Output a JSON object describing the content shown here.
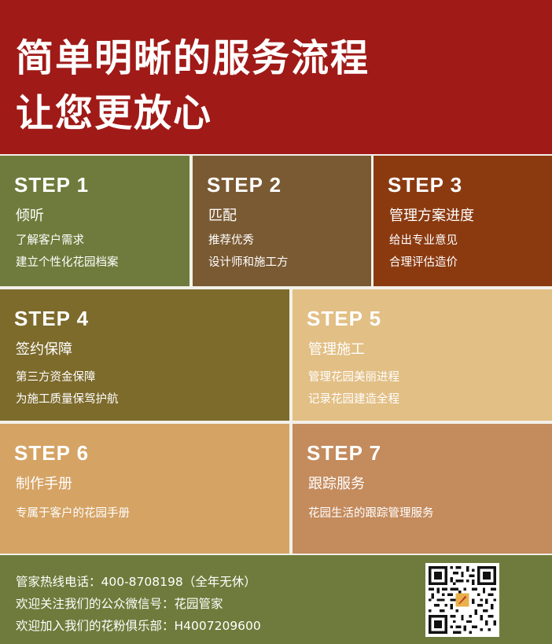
{
  "header": {
    "line1": "简单明晰的服务流程",
    "line2": "让您更放心"
  },
  "steps": [
    {
      "step": "STEP 1",
      "title": "倾听",
      "lines": [
        "了解客户需求",
        "建立个性化花园档案"
      ],
      "bg": "#6f7b3c",
      "fg": "#ffffff"
    },
    {
      "step": "STEP 2",
      "title": "匹配",
      "lines": [
        "推荐优秀",
        "设计师和施工方"
      ],
      "bg": "#7a5a33",
      "fg": "#ffffff"
    },
    {
      "step": "STEP 3",
      "title": "管理方案进度",
      "lines": [
        "给出专业意见",
        "合理评估造价"
      ],
      "bg": "#8b3a10",
      "fg": "#ffffff"
    },
    {
      "step": "STEP 4",
      "title": "签约保障",
      "lines": [
        "第三方资金保障",
        "为施工质量保驾护航"
      ],
      "bg": "#7d6b2c",
      "fg": "#ffffff"
    },
    {
      "step": "STEP 5",
      "title": "管理施工",
      "lines": [
        "管理花园美丽进程",
        "记录花园建造全程"
      ],
      "bg": "#e2bf85",
      "fg": "#ffffff"
    },
    {
      "step": "STEP 6",
      "title": "制作手册",
      "lines": [
        "专属于客户的花园手册"
      ],
      "bg": "#d5a364",
      "fg": "#ffffff"
    },
    {
      "step": "STEP 7",
      "title": "跟踪服务",
      "lines": [
        "花园生活的跟踪管理服务"
      ],
      "bg": "#c48b5d",
      "fg": "#ffffff"
    }
  ],
  "footer": {
    "line1": "管家热线电话：400-8708198（全年无休）",
    "line2": "欢迎关注我们的公众微信号：花园管家",
    "line3": "欢迎加入我们的花粉俱乐部：H4007209600"
  },
  "colors": {
    "header_bg": "#a01a17",
    "footer_bg": "#6f7b3c",
    "divider": "#f2f0ea"
  },
  "qr": {
    "icon": "qr-code-icon"
  }
}
